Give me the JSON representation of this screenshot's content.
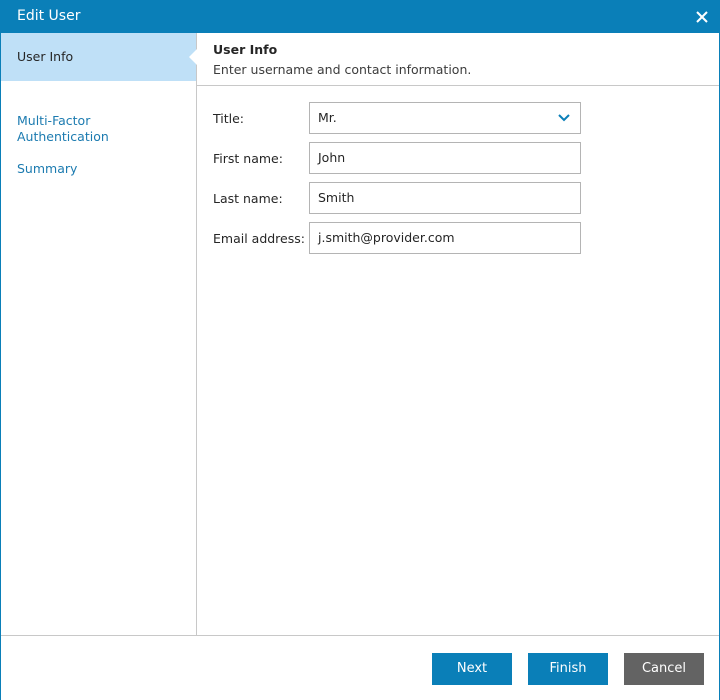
{
  "window": {
    "title": "Edit User"
  },
  "sidebar": {
    "items": [
      {
        "label": "User Info",
        "active": true
      },
      {
        "label": "Multi-Factor\nAuthentication",
        "active": false
      },
      {
        "label": "Summary",
        "active": false
      }
    ]
  },
  "header": {
    "title": "User Info",
    "subtitle": "Enter username and contact information."
  },
  "form": {
    "title_label": "Title:",
    "title_value": "Mr.",
    "first_name_label": "First name:",
    "first_name_value": "John",
    "last_name_label": "Last name:",
    "last_name_value": "Smith",
    "email_label": "Email address:",
    "email_value": "j.smith@provider.com"
  },
  "footer": {
    "next_label": "Next",
    "finish_label": "Finish",
    "cancel_label": "Cancel"
  },
  "icons": {
    "close": "close-icon",
    "dropdown": "chevron-down-icon"
  },
  "colors": {
    "accent": "#0a7fb8",
    "active_nav_bg": "#bfe0f7",
    "nav_link": "#1c7bb0",
    "cancel_bg": "#636363"
  }
}
